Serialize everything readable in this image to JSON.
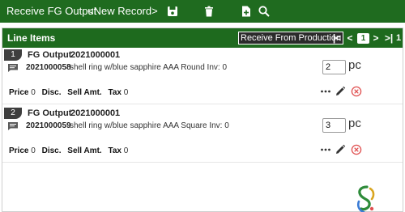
{
  "toolbar": {
    "title": "Receive FG Output",
    "record_label": "<New Record>",
    "icons": [
      "save-icon",
      "delete-icon",
      "add-document-icon",
      "search-icon"
    ]
  },
  "panel": {
    "title": "Line Items",
    "receive_button": "Receive From Production",
    "pager": {
      "first": "|<",
      "prev": "<",
      "current_page": "1",
      "next": ">",
      "last": ">|",
      "total": "1"
    }
  },
  "line_items": [
    {
      "index": "1",
      "header_label": "FG Output",
      "header_value": "2021000001",
      "item_code": "2021000058",
      "description": "shell ring w/blue sapphire AAA Round Inv: 0",
      "quantity": "2",
      "unit": "pc",
      "price_label": "Price",
      "price_value": "0",
      "disc_label": "Disc.",
      "sell_amt_label": "Sell Amt.",
      "tax_label": "Tax",
      "tax_value": "0"
    },
    {
      "index": "2",
      "header_label": "FG Output",
      "header_value": "2021000001",
      "item_code": "2021000059",
      "description": "shell ring w/blue sapphire AAA Square Inv: 0",
      "quantity": "3",
      "unit": "pc",
      "price_label": "Price",
      "price_value": "0",
      "disc_label": "Disc.",
      "sell_amt_label": "Sell Amt.",
      "tax_label": "Tax",
      "tax_value": "0"
    }
  ],
  "colors": {
    "toolbar_bg": "#1f6b1f",
    "accent_red": "#e05050"
  }
}
